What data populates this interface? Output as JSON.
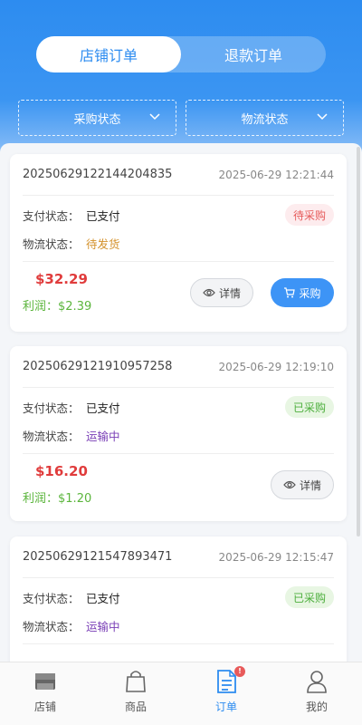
{
  "tabs": {
    "store_orders": "店铺订单",
    "refund_orders": "退款订单"
  },
  "filters": {
    "purchase_status": "采购状态",
    "logistics_status": "物流状态"
  },
  "labels": {
    "pay_status": "支付状态：",
    "logistics_status": "物流状态：",
    "profit_prefix": "利润："
  },
  "buttons": {
    "detail": "详情",
    "purchase": "采购"
  },
  "colors": {
    "accent": "#2d8cf0",
    "price": "#e03c3c",
    "profit": "#5bb53c",
    "pending_tag": "#e65a5a",
    "done_tag": "#4cae3c",
    "shipping": "#d4922c",
    "in_transit": "#7a3fb6"
  },
  "orders": [
    {
      "order_no": "20250629122144204835",
      "time": "2025-06-29 12:21:44",
      "pay_status": "已支付",
      "logistics_status": "待发货",
      "logistics_color": "#d4922c",
      "purchase_tag": "待采购",
      "tag_type": "pending",
      "price": "$32.29",
      "profit": "$2.39",
      "show_purchase_button": true
    },
    {
      "order_no": "20250629121910957258",
      "time": "2025-06-29 12:19:10",
      "pay_status": "已支付",
      "logistics_status": "运输中",
      "logistics_color": "#7a3fb6",
      "purchase_tag": "已采购",
      "tag_type": "done",
      "price": "$16.20",
      "profit": "$1.20",
      "show_purchase_button": false
    },
    {
      "order_no": "20250629121547893471",
      "time": "2025-06-29 12:15:47",
      "pay_status": "已支付",
      "logistics_status": "运输中",
      "logistics_color": "#7a3fb6",
      "purchase_tag": "已采购",
      "tag_type": "done",
      "price": "",
      "profit": "",
      "show_purchase_button": false
    }
  ],
  "tabbar": [
    {
      "label": "店铺",
      "icon": "store-icon"
    },
    {
      "label": "商品",
      "icon": "bag-icon"
    },
    {
      "label": "订单",
      "icon": "order-document-icon",
      "badge": "!"
    },
    {
      "label": "我的",
      "icon": "user-icon"
    }
  ]
}
